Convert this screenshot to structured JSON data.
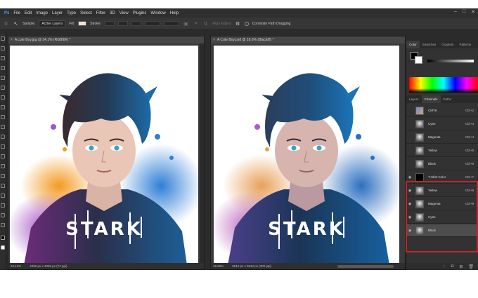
{
  "menu": [
    "File",
    "Edit",
    "Image",
    "Layer",
    "Type",
    "Select",
    "Filter",
    "3D",
    "View",
    "Plugins",
    "Window",
    "Help"
  ],
  "window_controls": [
    "–",
    "□",
    "✕"
  ],
  "options": {
    "tool_label": "Sample:",
    "sample_value": "Active Layers",
    "fill_label": "Fill:",
    "stroke_label": "Stroke:",
    "align_edges": "Align Edges",
    "constrain": "Constrain Path Dragging"
  },
  "doc1": {
    "tab": "A cute Boy.jpg @ 34.1% (RGB/8#) *",
    "zoom": "34.12%",
    "size": "4096 px x 4096 px (72 ppi)",
    "art_text": "STARK"
  },
  "doc2": {
    "tab": "A Cute Boy.psd @ 18.6% (Black/8) *",
    "zoom": "18.69%",
    "size": "9912 px x 9912 px (300 ppi)",
    "art_text": "STARK"
  },
  "panels": {
    "top_tabs": [
      "Color",
      "Swatches",
      "Gradient",
      "Patterns"
    ],
    "bottom_tabs": [
      "Layers",
      "Channels",
      "Paths"
    ],
    "channels": [
      {
        "name": "CMYK",
        "shortcut": "Ctrl+2",
        "thumb": "color"
      },
      {
        "name": "Cyan",
        "shortcut": "Ctrl+3",
        "thumb": "gray"
      },
      {
        "name": "Magenta",
        "shortcut": "Ctrl+4",
        "thumb": "gray"
      },
      {
        "name": "Yellow",
        "shortcut": "Ctrl+5",
        "thumb": "gray"
      },
      {
        "name": "Black",
        "shortcut": "Ctrl+6",
        "thumb": "gray"
      },
      {
        "name": "T-Shirt Color",
        "shortcut": "Ctrl+7",
        "thumb": "black"
      },
      {
        "name": "Yellow",
        "shortcut": "Ctrl+8",
        "thumb": "gray"
      },
      {
        "name": "Magenta",
        "shortcut": "Ctrl+9",
        "thumb": "gray"
      },
      {
        "name": "Cyan",
        "shortcut": "",
        "thumb": "gray"
      },
      {
        "name": "Black",
        "shortcut": "",
        "thumb": "gray"
      }
    ]
  },
  "colors": {
    "highlight": "#c2262c",
    "hair": "#1f4b6e",
    "orange": "#f08a1c",
    "purple": "#8d3fa8",
    "blue": "#2a74c9"
  }
}
